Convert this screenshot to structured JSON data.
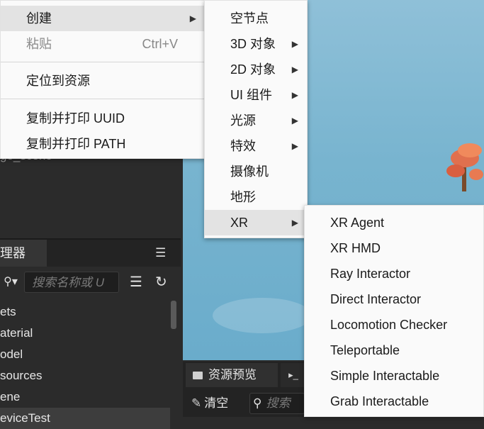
{
  "context_menu": {
    "items": [
      {
        "label": "创建",
        "has_submenu": true,
        "active": true
      },
      {
        "label": "粘贴",
        "shortcut": "Ctrl+V",
        "disabled": true
      },
      {
        "label": "定位到资源"
      },
      {
        "label": "复制并打印 UUID"
      },
      {
        "label": "复制并打印 PATH"
      }
    ]
  },
  "create_submenu": {
    "items": [
      {
        "label": "空节点"
      },
      {
        "label": "3D 对象",
        "has_submenu": true
      },
      {
        "label": "2D 对象",
        "has_submenu": true
      },
      {
        "label": "UI 组件",
        "has_submenu": true
      },
      {
        "label": "光源",
        "has_submenu": true
      },
      {
        "label": "特效",
        "has_submenu": true
      },
      {
        "label": "摄像机"
      },
      {
        "label": "地形"
      },
      {
        "label": "XR",
        "has_submenu": true,
        "active": true
      }
    ]
  },
  "xr_submenu": {
    "items": [
      {
        "label": "XR Agent"
      },
      {
        "label": "XR HMD"
      },
      {
        "label": "Ray Interactor"
      },
      {
        "label": "Direct Interactor"
      },
      {
        "label": "Locomotion Checker"
      },
      {
        "label": "Teleportable"
      },
      {
        "label": "Simple Interactable"
      },
      {
        "label": "Grab Interactable"
      }
    ]
  },
  "hierarchy": {
    "peek_text": "ge_scene"
  },
  "assets_panel": {
    "tab_label": "理器",
    "search_placeholder": "搜索名称或 U",
    "tree_items": [
      "ets",
      "aterial",
      "odel",
      "sources",
      "ene",
      "eviceTest"
    ]
  },
  "bottom_panel": {
    "preview_tab": "资源预览",
    "console_tab": "▸_",
    "clear_label": "清空",
    "search_placeholder": "搜索"
  },
  "icons": {
    "submenu_arrow": "triangle-right-icon",
    "hamburger": "hamburger-icon",
    "search": "search-icon",
    "list": "list-view-icon",
    "refresh": "refresh-icon",
    "clear": "brush-icon"
  }
}
